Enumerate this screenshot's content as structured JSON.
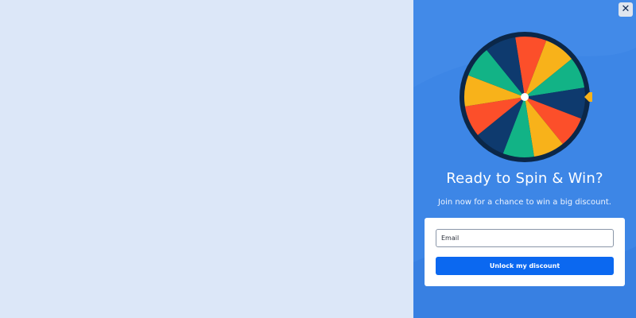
{
  "popup": {
    "close_label": "✕",
    "headline": "Ready to Spin & Win?",
    "subheadline": "Join now for a chance to win a big discount.",
    "email_placeholder": "Email",
    "email_value": "",
    "cta_label": "Unlock my discount"
  },
  "wheel": {
    "segment_colors": [
      "#fc4f2a",
      "#f8b21a",
      "#12b386",
      "#0e3a6e",
      "#fc4f2a",
      "#f8b21a",
      "#12b386",
      "#0e3a6e",
      "#fc4f2a",
      "#f8b21a",
      "#12b386",
      "#0e3a6e"
    ],
    "rim_color": "#0b2748",
    "hub_color": "#ffffff",
    "pointer_color": "#f8b21a"
  },
  "colors": {
    "backdrop": "#dce7f8",
    "panel": "#3d86e6",
    "button": "#0b68f0"
  },
  "icons": {
    "close": "close-icon",
    "pointer": "wheel-pointer-icon"
  }
}
